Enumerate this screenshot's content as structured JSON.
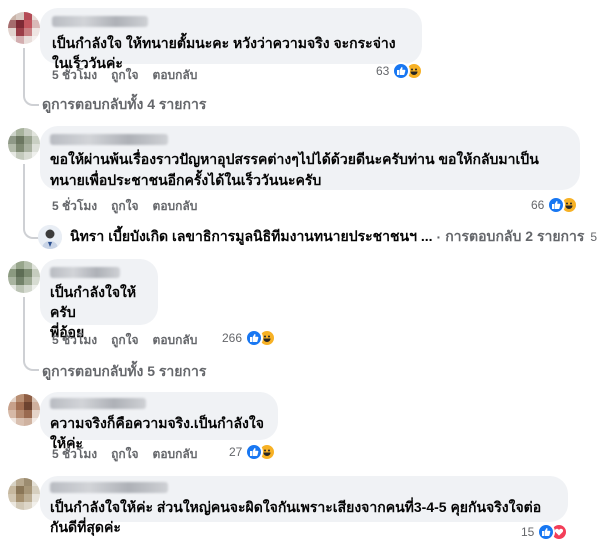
{
  "comments": [
    {
      "text": "เป็นกำลังใจ ให้ทนายตั้มนะคะ หวังว่าความจริง จะกระจ่าง ในเร็ววันค่ะ",
      "time": "5 ชั่วโมง",
      "like_label": "ถูกใจ",
      "reply_label": "ตอบกลับ",
      "reactions": "63",
      "reaction_types": [
        "like-icon",
        "haha-icon"
      ],
      "view_replies": "ดูการตอบกลับทั้ง 4 รายการ"
    },
    {
      "text": "ขอให้ผ่านพ้นเรื่องราวปัญหาอุปสรรคต่างๆไปได้ด้วยดีนะครับท่าน ขอให้กลับมาเป็นทนายเพื่อประชาชนอีกครั้งได้ในเร็ววันนะครับ",
      "time": "5 ชั่วโมง",
      "like_label": "ถูกใจ",
      "reply_label": "ตอบกลับ",
      "reactions": "66",
      "reaction_types": [
        "like-icon",
        "haha-icon"
      ],
      "reply_preview": {
        "name": "นิทรา",
        "text": "เบี้ยบังเกิด เลขาธิการมูลนิธิทีมงานทนายประชาชนฯ ...",
        "sep": "·",
        "count": "การตอบกลับ 2 รายการ",
        "time": "5 ชั่วโม"
      }
    },
    {
      "text": "เป็นกำลังใจให้ครับ",
      "text2": "พี่อ้อย",
      "time": "5 ชั่วโมง",
      "like_label": "ถูกใจ",
      "reply_label": "ตอบกลับ",
      "reactions": "266",
      "reaction_types": [
        "like-icon",
        "haha-icon"
      ],
      "view_replies": "ดูการตอบกลับทั้ง 5 รายการ"
    },
    {
      "text": "ความจริงก็คือความจริง.เป็นกำลังใจให้ค่ะ",
      "time": "5 ชั่วโมง",
      "like_label": "ถูกใจ",
      "reply_label": "ตอบกลับ",
      "reactions": "27",
      "reaction_types": [
        "like-icon",
        "haha-icon"
      ]
    },
    {
      "text": "เป็นกำลังใจให้ค่ะ ส่วนใหญ่คนจะผิดใจกันเพราะเสียงจากคนที่3-4-5 คุยกันจริงใจต่อกันดีที่สุดค่ะ",
      "time": "5 ชั่วโมง",
      "like_label": "ถูกใจ",
      "reply_label": "ตอบกลับ",
      "reactions": "15",
      "reaction_types": [
        "like-icon",
        "love-icon"
      ]
    }
  ],
  "colors": {
    "like": "#1877f2",
    "haha": "#f7b125",
    "love": "#f33e58",
    "bubble": "#f0f2f5",
    "meta": "#65676b"
  }
}
